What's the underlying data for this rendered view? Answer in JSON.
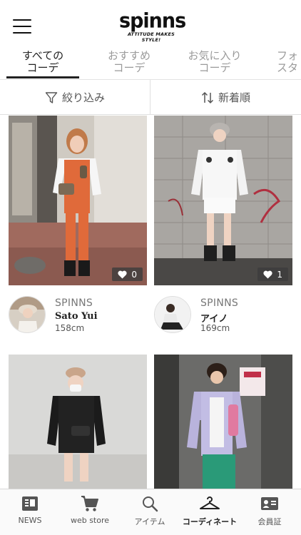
{
  "header": {
    "logo_text": "spinns",
    "logo_tagline": "ATTITUDE MAKES STYLE!"
  },
  "tabs": [
    {
      "line1": "すべての",
      "line2": "コーデ",
      "active": true
    },
    {
      "line1": "おすすめ",
      "line2": "コーデ",
      "active": false
    },
    {
      "line1": "お気に入り",
      "line2": "コーデ",
      "active": false
    },
    {
      "line1": "フォ",
      "line2": "スタ",
      "active": false
    }
  ],
  "filter": {
    "filter_label": "絞り込み",
    "sort_label": "新着順"
  },
  "cards": [
    {
      "likes": "0",
      "brand": "SPINNS",
      "name": "Sato Yui",
      "height": "158cm"
    },
    {
      "likes": "1",
      "brand": "SPINNS",
      "name": "アイノ",
      "height": "169cm"
    },
    {
      "likes": "",
      "brand": "",
      "name": "",
      "height": ""
    },
    {
      "likes": "",
      "brand": "",
      "name": "",
      "height": ""
    }
  ],
  "bottom_nav": [
    {
      "label": "NEWS",
      "icon": "news-icon"
    },
    {
      "label": "web store",
      "icon": "cart-icon"
    },
    {
      "label": "アイテム",
      "icon": "search-icon"
    },
    {
      "label": "コーディネート",
      "icon": "hanger-icon",
      "active": true
    },
    {
      "label": "会員証",
      "icon": "member-card-icon"
    }
  ],
  "colors": {
    "active_text": "#222222",
    "inactive_text": "#9a9a9a",
    "like_badge": "#3c3c3c"
  }
}
